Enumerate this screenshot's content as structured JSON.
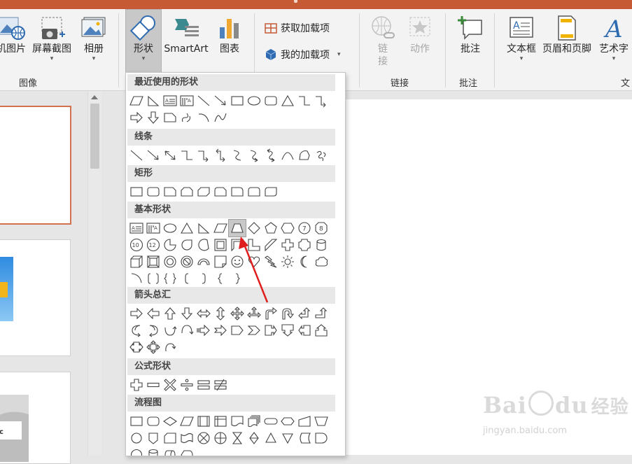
{
  "ribbon": {
    "online_pictures_label": "机图片",
    "screenshot_label": "屏幕截图",
    "album_label": "相册",
    "images_group_label": "图像",
    "shapes_label": "形状",
    "smartart_label": "SmartArt",
    "chart_label": "图表",
    "get_addins_label": "获取加载项",
    "my_addins_label": "我的加载项",
    "link_label": "链接",
    "action_label": "动作",
    "links_group_label": "链接",
    "comment_label": "批注",
    "comments_group_label": "批注",
    "textbox_label": "文本框",
    "header_footer_label": "页眉和页脚",
    "wordart_label": "艺术字",
    "text_group_label": "文"
  },
  "shapes_menu": {
    "recent_label": "最近使用的形状",
    "lines_label": "线条",
    "rectangles_label": "矩形",
    "basic_label": "基本形状",
    "arrows_label": "箭头总汇",
    "equation_label": "公式形状",
    "flowchart_label": "流程图",
    "selected_shape": "trapezoid",
    "sections": [
      {
        "key": "recent",
        "rows": [
          [
            "parallelogram",
            "right-triangle",
            "textbox",
            "vertical-textbox",
            "line",
            "line-arrow",
            "rectangle",
            "oval",
            "rounded-rectangle",
            "triangle",
            "elbow-connector",
            "elbow-arrow-connector"
          ],
          [
            "right-arrow",
            "down-arrow",
            "snip-corner",
            "freeform-curve",
            "arc",
            "wave-curve"
          ]
        ]
      },
      {
        "key": "lines",
        "rows": [
          [
            "line",
            "line-arrow",
            "line-double-arrow",
            "elbow-connector",
            "elbow-arrow-connector",
            "elbow-double-arrow",
            "curved-connector",
            "curved-arrow-connector",
            "curved-double-arrow",
            "curve",
            "freeform",
            "scribble"
          ]
        ]
      },
      {
        "key": "rectangles",
        "rows": [
          [
            "rectangle",
            "rounded-rectangle",
            "snip-single",
            "snip-same-side",
            "snip-diagonal",
            "snip-round",
            "round-single",
            "round-same-side",
            "round-diagonal"
          ]
        ]
      },
      {
        "key": "basic",
        "rows": [
          [
            "textbox",
            "vertical-textbox",
            "oval",
            "triangle",
            "right-triangle",
            "parallelogram",
            "trapezoid",
            "diamond",
            "pentagon",
            "hexagon",
            "heptagon",
            "octagon"
          ],
          [
            "decagon",
            "dodecagon",
            "pie",
            "teardrop",
            "chord",
            "frame",
            "half-frame",
            "l-shape",
            "diagonal-stripe",
            "cross",
            "plaque",
            "can"
          ],
          [
            "cube",
            "bevel",
            "donut",
            "no-symbol",
            "block-arc",
            "folded-corner",
            "smiley",
            "heart",
            "lightning",
            "sun",
            "moon",
            "cloud"
          ],
          [
            "arc-bracket",
            "double-bracket",
            "double-brace",
            "left-bracket",
            "right-bracket",
            "left-brace",
            "right-brace"
          ]
        ]
      },
      {
        "key": "arrows",
        "rows": [
          [
            "right-arrow",
            "left-arrow",
            "up-arrow",
            "down-arrow",
            "left-right-arrow",
            "up-down-arrow",
            "quad-arrow",
            "left-right-up-arrow",
            "bent-arrow",
            "u-turn-arrow",
            "left-up-arrow",
            "bent-up-arrow"
          ],
          [
            "curved-right-arrow",
            "curved-left-arrow",
            "curved-up-arrow",
            "curved-down-arrow",
            "striped-right-arrow",
            "notched-right-arrow",
            "pentagon-arrow",
            "chevron",
            "right-arrow-callout",
            "down-arrow-callout",
            "left-arrow-callout",
            "up-arrow-callout"
          ],
          [
            "left-right-arrow-callout",
            "quad-arrow-callout",
            "circular-arrow"
          ]
        ]
      },
      {
        "key": "equation",
        "rows": [
          [
            "plus",
            "minus",
            "multiply",
            "divide",
            "equal",
            "not-equal"
          ]
        ]
      },
      {
        "key": "flowchart",
        "rows": [
          [
            "process",
            "alternate-process",
            "decision",
            "data",
            "predefined-process",
            "internal-storage",
            "document",
            "multidocument",
            "terminator",
            "preparation",
            "manual-input",
            "manual-operation"
          ],
          [
            "connector",
            "off-page-connector",
            "card",
            "punched-tape",
            "summing-junction",
            "or",
            "collate",
            "sort",
            "extract",
            "merge",
            "stored-data",
            "delay"
          ],
          [
            "sequential-storage",
            "magnetic-disk",
            "direct-access-storage",
            "display"
          ]
        ]
      }
    ]
  },
  "watermark": {
    "brand": "Bai",
    "suffix": "du",
    "cn": "经验",
    "url": "jingyan.baidu.com"
  },
  "colors": {
    "title_bar": "#c55a35",
    "annotation_arrow": "#e01e1e",
    "selected_thumb_border": "#d0724f"
  }
}
